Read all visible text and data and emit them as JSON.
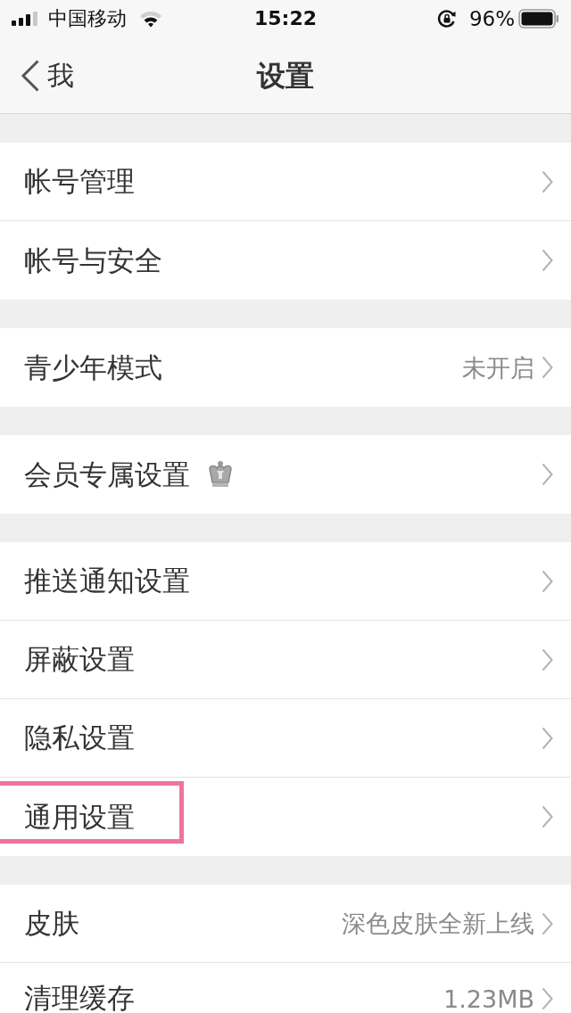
{
  "status_bar": {
    "carrier": "中国移动",
    "time": "15:22",
    "battery": "96%"
  },
  "nav_bar": {
    "back_label": "我",
    "title": "设置"
  },
  "groups": [
    {
      "items": [
        {
          "label": "帐号管理",
          "vip_badge": false,
          "annotated": false
        },
        {
          "label": "帐号与安全",
          "vip_badge": false,
          "annotated": false
        }
      ]
    },
    {
      "items": [
        {
          "label": "青少年模式",
          "value": "未开启",
          "vip_badge": false,
          "annotated": false
        }
      ]
    },
    {
      "items": [
        {
          "label": "会员专属设置",
          "vip_badge": true,
          "annotated": false
        }
      ]
    },
    {
      "items": [
        {
          "label": "推送通知设置",
          "vip_badge": false,
          "annotated": false
        },
        {
          "label": "屏蔽设置",
          "vip_badge": false,
          "annotated": false
        },
        {
          "label": "隐私设置",
          "vip_badge": false,
          "annotated": false
        },
        {
          "label": "通用设置",
          "vip_badge": false,
          "annotated": true
        }
      ]
    },
    {
      "items": [
        {
          "label": "皮肤",
          "value": "深色皮肤全新上线",
          "vip_badge": false,
          "annotated": false
        },
        {
          "label": "清理缓存",
          "value": "1.23MB",
          "vip_badge": false,
          "annotated": false
        }
      ]
    }
  ]
}
